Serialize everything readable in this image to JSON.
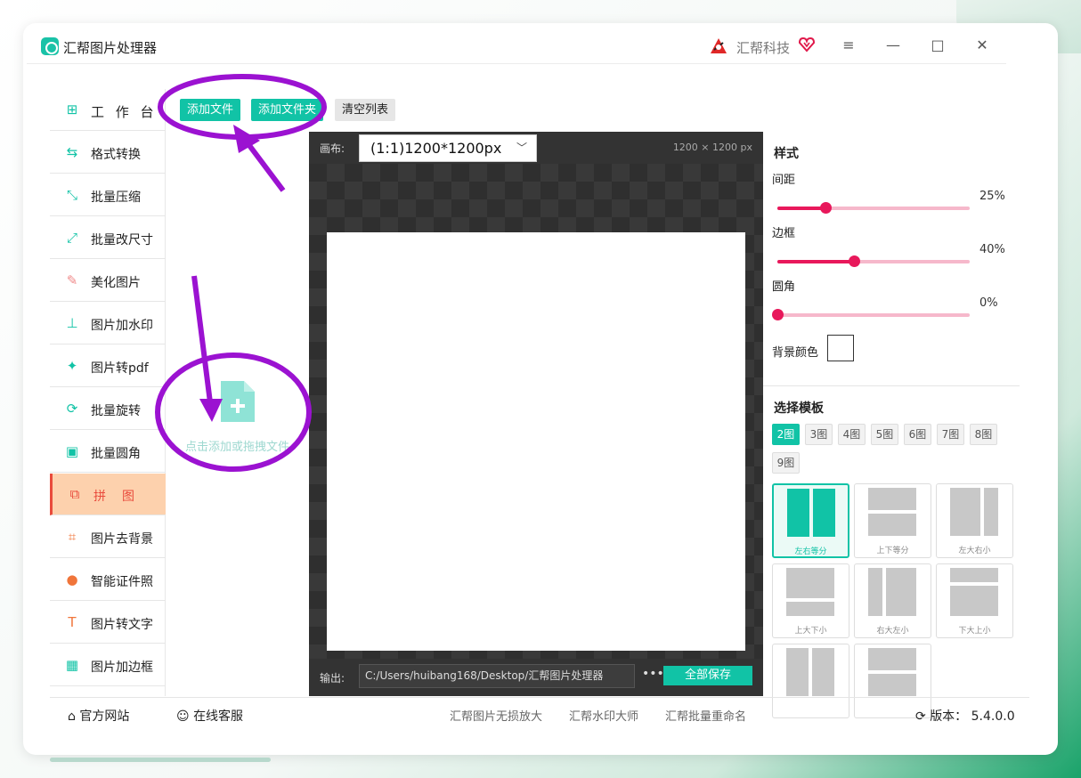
{
  "app": {
    "title": "汇帮图片处理器",
    "brand": "汇帮科技"
  },
  "window_controls": [
    "≡",
    "—",
    "□",
    "✕"
  ],
  "sidebar": {
    "items": [
      {
        "label": "工 作 台",
        "icon": "grid-icon",
        "color": "#11c3a6"
      },
      {
        "label": "格式转换",
        "icon": "convert-icon",
        "color": "#11c3a6"
      },
      {
        "label": "批量压缩",
        "icon": "compress-icon",
        "color": "#11c3a6"
      },
      {
        "label": "批量改尺寸",
        "icon": "resize-icon",
        "color": "#11c3a6"
      },
      {
        "label": "美化图片",
        "icon": "beautify-icon",
        "color": "#f08a8a"
      },
      {
        "label": "图片加水印",
        "icon": "watermark-icon",
        "color": "#11c3a6"
      },
      {
        "label": "图片转pdf",
        "icon": "pdf-icon",
        "color": "#11c3a6"
      },
      {
        "label": "批量旋转",
        "icon": "rotate-icon",
        "color": "#11c3a6"
      },
      {
        "label": "批量圆角",
        "icon": "round-corner-icon",
        "color": "#11c3a6"
      },
      {
        "label": "拼　图",
        "icon": "collage-icon",
        "color": "#e94b3c",
        "active": true
      },
      {
        "label": "图片去背景",
        "icon": "crop-icon",
        "color": "#f0753a"
      },
      {
        "label": "智能证件照",
        "icon": "person-icon",
        "color": "#f0753a"
      },
      {
        "label": "图片转文字",
        "icon": "text-icon",
        "color": "#f0753a"
      },
      {
        "label": "图片加边框",
        "icon": "frame-icon",
        "color": "#11c3a6"
      }
    ]
  },
  "toolbar": {
    "add_file": "添加文件",
    "add_folder": "添加文件夹",
    "clear_list": "清空列表"
  },
  "file_panel": {
    "drop_hint": "点击添加或拖拽文件"
  },
  "canvas": {
    "label": "画布:",
    "selected": "(1:1)1200*1200px",
    "size_text": "1200 × 1200 px",
    "output_label": "输出:",
    "output_path": "C:/Users/huibang168/Desktop/汇帮图片处理器",
    "more": "•••",
    "save_all": "全部保存"
  },
  "style_panel": {
    "title": "样式",
    "spacing": {
      "label": "间距",
      "value": "25%",
      "level": 0.25
    },
    "border": {
      "label": "边框",
      "value": "40%",
      "level": 0.4
    },
    "corner": {
      "label": "圆角",
      "value": "0%",
      "level": 0.0
    },
    "bg_color": {
      "label": "背景颜色",
      "color": "#ffffff"
    }
  },
  "template_panel": {
    "title": "选择模板",
    "counts": [
      "2图",
      "3图",
      "4图",
      "5图",
      "6图",
      "7图",
      "8图",
      "9图"
    ],
    "selected_count": "2图",
    "templates": [
      "左右等分",
      "上下等分",
      "左大右小",
      "上大下小",
      "右大左小",
      "下大上小",
      "",
      ""
    ],
    "selected_template": "左右等分"
  },
  "footer": {
    "website": "官方网站",
    "service": "在线客服",
    "links": [
      "汇帮图片无损放大",
      "汇帮水印大师",
      "汇帮批量重命名"
    ],
    "version_label": "版本：",
    "version": "5.4.0.0"
  },
  "colors": {
    "accent": "#11c3a6",
    "slider": "#e8185b",
    "active_bg": "#fdd1ad",
    "annotation": "#9b12d1"
  }
}
